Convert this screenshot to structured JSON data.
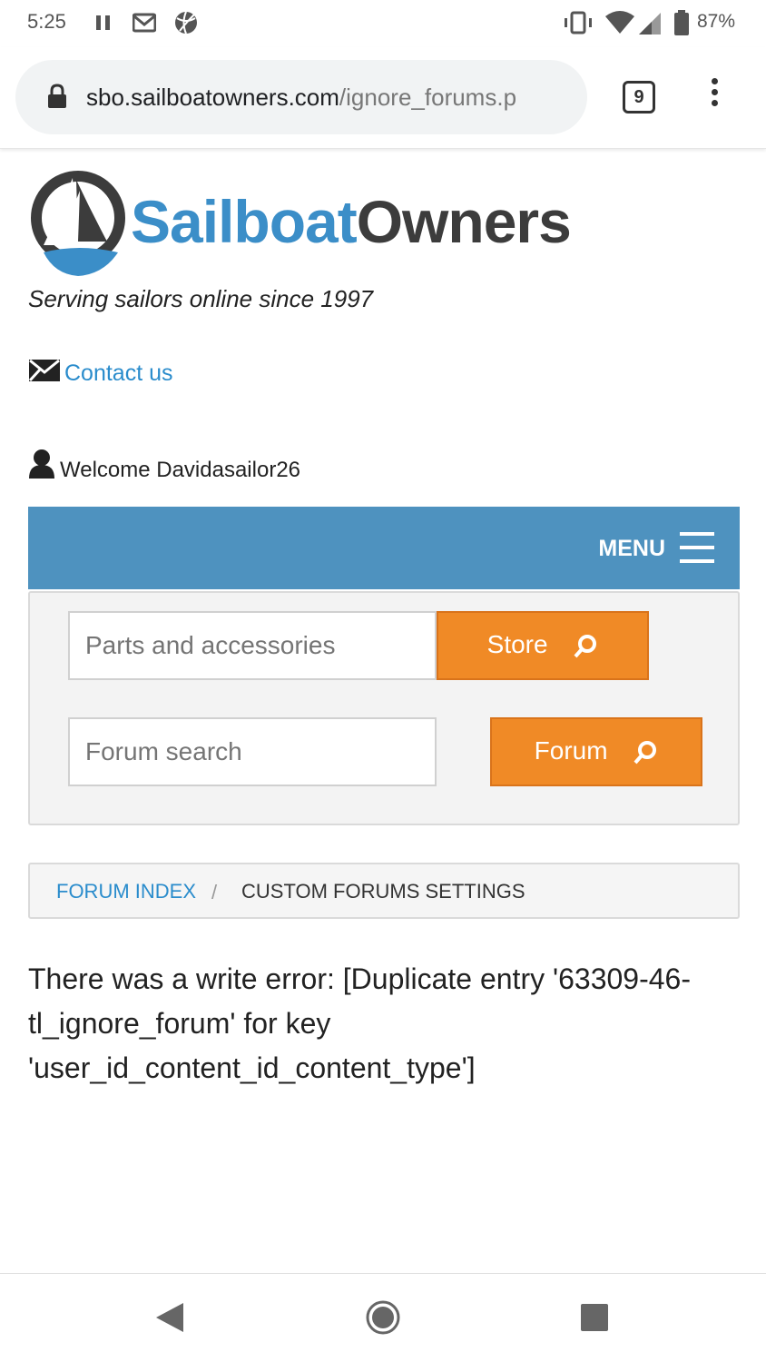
{
  "status_bar": {
    "time": "5:25",
    "battery": "87%",
    "icons": [
      "pause-icon",
      "gmail-icon",
      "basketball-icon",
      "vibrate-icon",
      "wifi-icon",
      "signal-icon",
      "battery-icon"
    ]
  },
  "browser": {
    "url_domain": "sbo.sailboatowners.com",
    "url_path": "/ignore_forums.p",
    "tab_count": "9"
  },
  "site": {
    "logo_part1": "Sailboat",
    "logo_part2": "Owners",
    "tagline": "Serving sailors online since 1997",
    "contact_label": "Contact us",
    "welcome_text": "Welcome Davidasailor26",
    "menu_label": "MENU",
    "colors": {
      "brand_blue": "#3b8ec8",
      "menu_bar": "#4e92bf",
      "button_orange": "#f08a26",
      "link_blue": "#2a8ccc"
    }
  },
  "search": {
    "store_placeholder": "Parts and accessories",
    "store_button": "Store",
    "forum_placeholder": "Forum search",
    "forum_button": "Forum"
  },
  "breadcrumb": {
    "link": "FORUM INDEX",
    "separator": "/",
    "current": "CUSTOM FORUMS SETTINGS"
  },
  "main": {
    "error_message": "There was a write error: [Duplicate entry '63309-46-tl_ignore_forum' for key 'user_id_content_id_content_type']"
  }
}
